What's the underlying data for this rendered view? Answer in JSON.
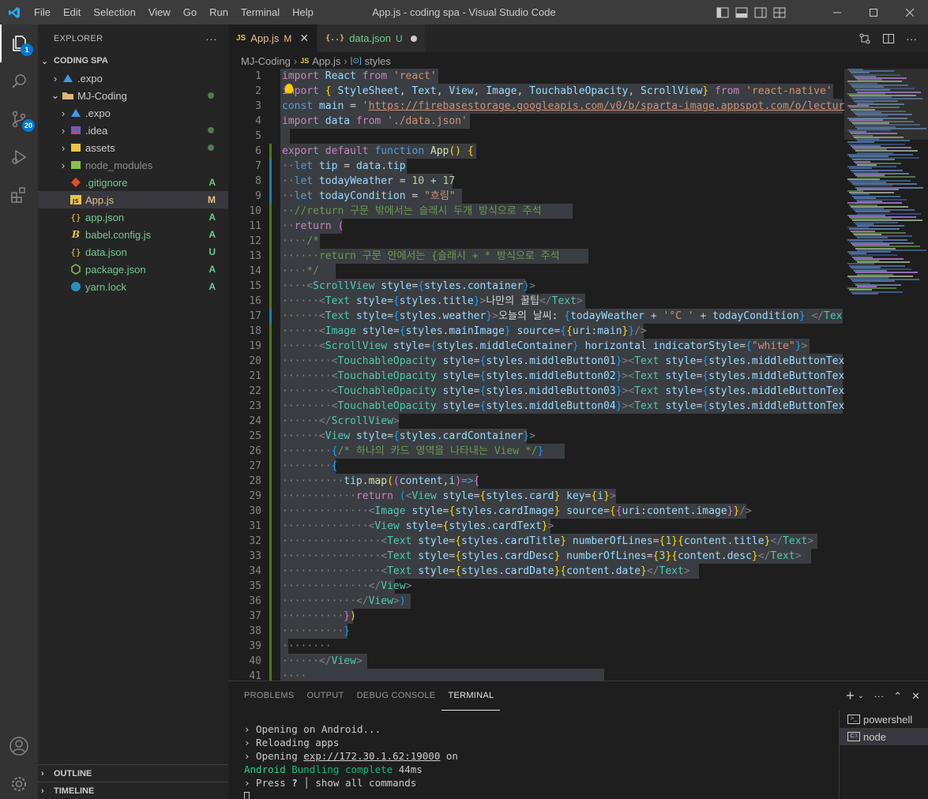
{
  "titlebar": {
    "menu": [
      "File",
      "Edit",
      "Selection",
      "View",
      "Go",
      "Run",
      "Terminal",
      "Help"
    ],
    "title": "App.js - coding spa - Visual Studio Code"
  },
  "activity": {
    "explorer_badge": "1",
    "scm_badge": "20"
  },
  "sidebar": {
    "header": "EXPLORER",
    "more": "···",
    "root": "CODING SPA",
    "items": [
      {
        "label": ".expo",
        "status": ""
      },
      {
        "label": "MJ-Coding",
        "status": ""
      },
      {
        "label": ".expo",
        "status": ""
      },
      {
        "label": ".idea",
        "status": ""
      },
      {
        "label": "assets",
        "status": ""
      },
      {
        "label": "node_modules",
        "status": ""
      },
      {
        "label": ".gitignore",
        "status": "A"
      },
      {
        "label": "App.js",
        "status": "M"
      },
      {
        "label": "app.json",
        "status": "A"
      },
      {
        "label": "babel.config.js",
        "status": "A"
      },
      {
        "label": "data.json",
        "status": "U"
      },
      {
        "label": "package.json",
        "status": "A"
      },
      {
        "label": "yarn.lock",
        "status": "A"
      }
    ],
    "outline": "OUTLINE",
    "timeline": "TIMELINE"
  },
  "tabs": [
    {
      "label": "App.js",
      "status": "M"
    },
    {
      "label": "data.json",
      "status": "U"
    }
  ],
  "breadcrumb": [
    "MJ-Coding",
    "App.js",
    "styles"
  ],
  "editor": {
    "line_numbers": [
      "1",
      "2",
      "3",
      "4",
      "5",
      "6",
      "7",
      "8",
      "9",
      "10",
      "11",
      "12",
      "13",
      "14",
      "15",
      "16",
      "17",
      "18",
      "19",
      "20",
      "21",
      "22",
      "23",
      "24",
      "25",
      "26",
      "27",
      "28",
      "29",
      "30",
      "31",
      "32",
      "33",
      "34",
      "35",
      "36",
      "37",
      "38",
      "39",
      "40",
      "41"
    ]
  },
  "panel": {
    "tabs": [
      "PROBLEMS",
      "OUTPUT",
      "DEBUG CONSOLE",
      "TERMINAL"
    ],
    "terminal_lines": [
      "› Opening on Android...",
      "› Reloading apps",
      "› Opening exp://172.30.1.62:19000 on",
      "Android Bundling complete 44ms",
      "› Press ? │ show all commands"
    ],
    "terminals": [
      "powershell",
      "node"
    ],
    "add": "+"
  },
  "colors": {
    "accent": "#0078d4",
    "modified": "#e2c08d",
    "added": "#73c991",
    "untracked": "#73c991"
  }
}
